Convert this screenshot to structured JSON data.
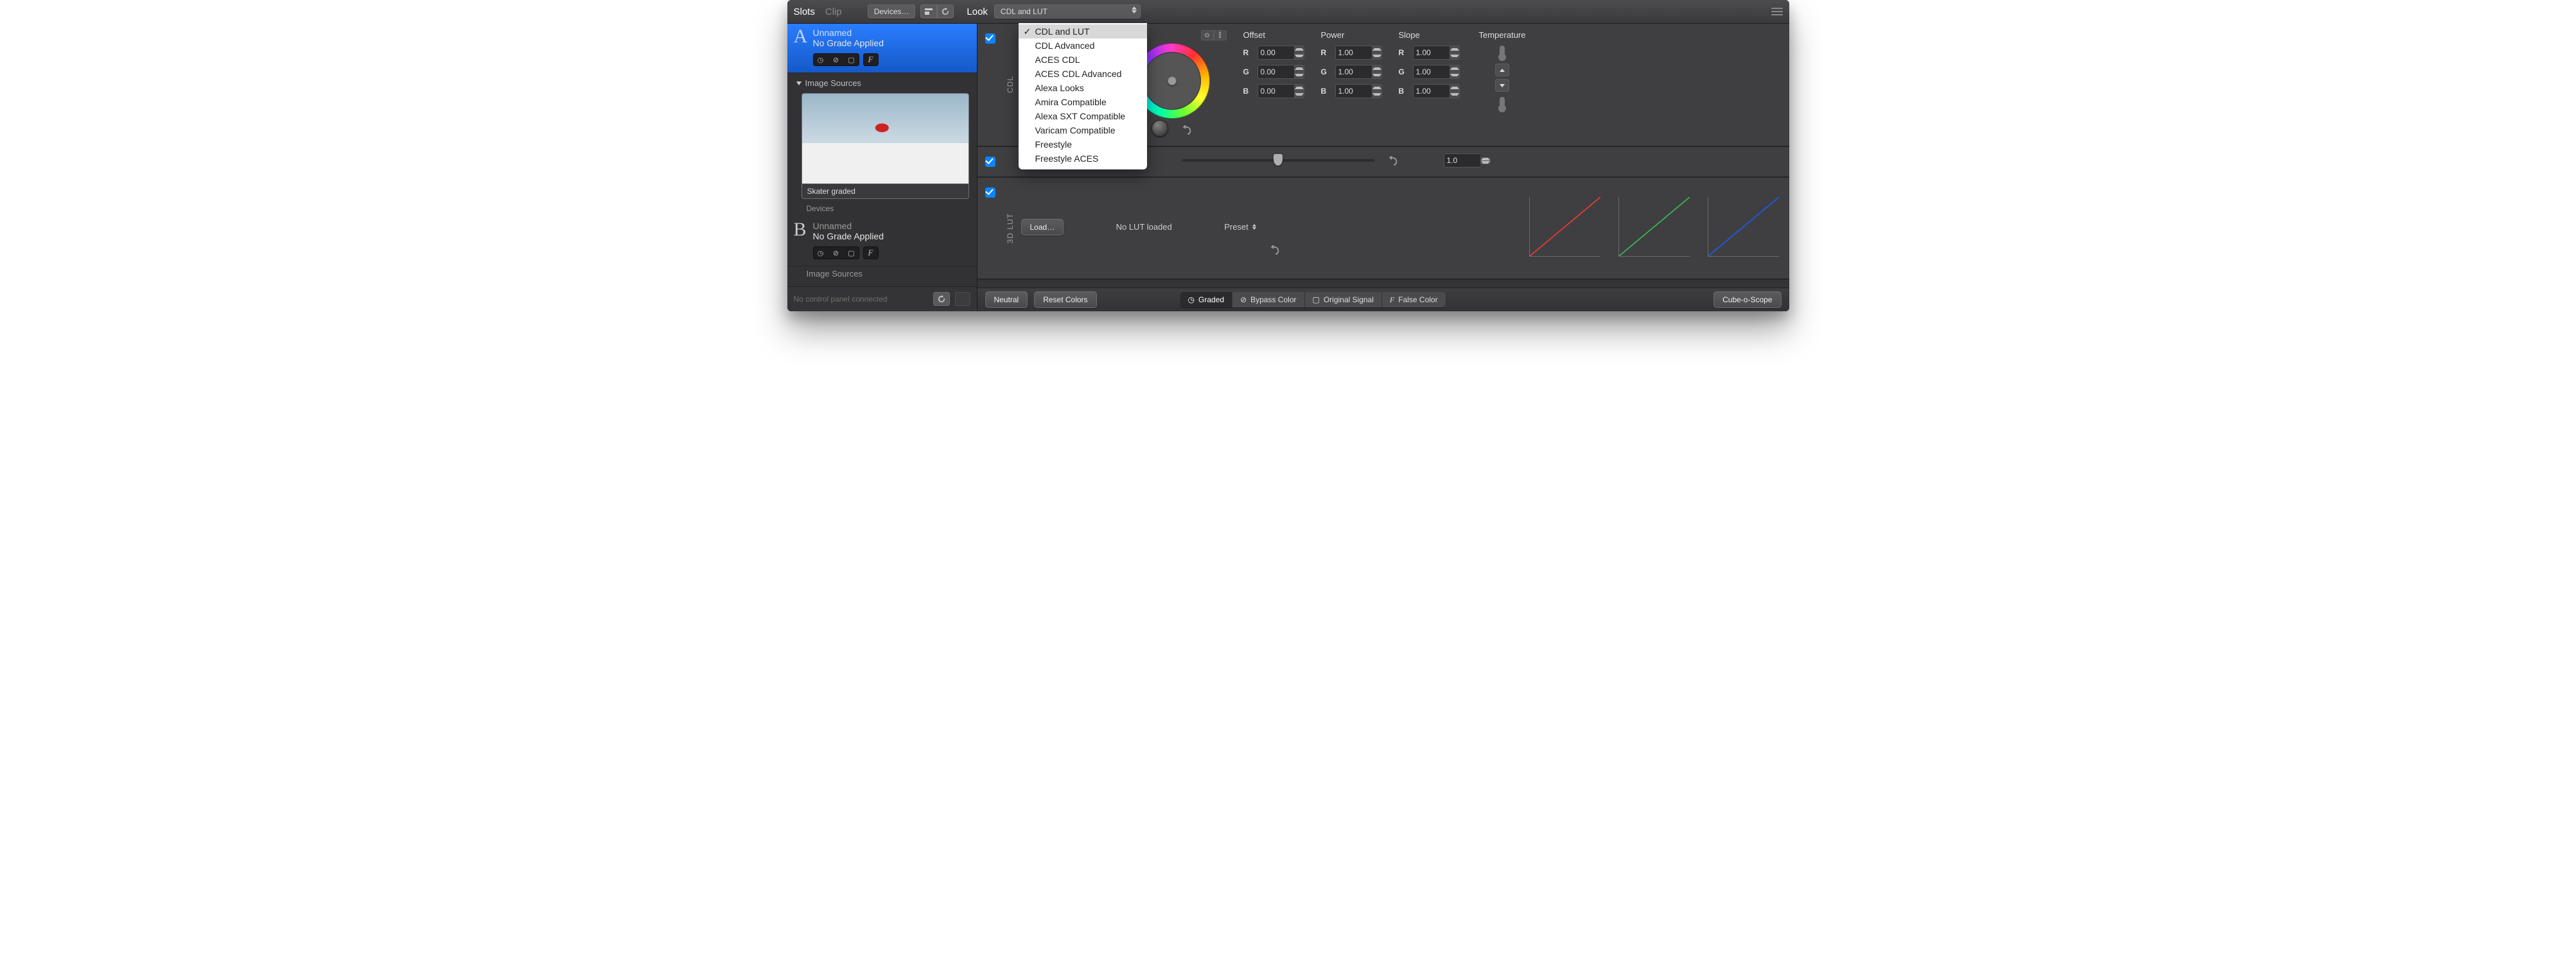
{
  "tabs": {
    "slots": "Slots",
    "clip": "Clip",
    "active": "slots"
  },
  "toolbar": {
    "devices_label": "Devices…"
  },
  "look": {
    "label": "Look",
    "selected": "CDL and LUT",
    "options": [
      "CDL and LUT",
      "CDL Advanced",
      "ACES CDL",
      "ACES CDL Advanced",
      "Alexa Looks",
      "Amira Compatible",
      "Alexa SXT Compatible",
      "Varicam Compatible",
      "Freestyle",
      "Freestyle ACES"
    ]
  },
  "sidebar": {
    "slotA": {
      "letter": "A",
      "name": "Unnamed",
      "sub": "No Grade Applied"
    },
    "slotB": {
      "letter": "B",
      "name": "Unnamed",
      "sub": "No Grade Applied"
    },
    "image_sources_label": "Image Sources",
    "thumb_label": "Skater graded",
    "devices_label": "Devices",
    "slotB_sources": "Image Sources",
    "footer_status": "No control panel connected"
  },
  "cdl": {
    "vlabel": "CDL",
    "wheel_partial_controls": "⊙ ⫿",
    "slope_label": "Slope",
    "offset": {
      "label": "Offset",
      "r": "0.00",
      "g": "0.00",
      "b": "0.00"
    },
    "power": {
      "label": "Power",
      "r": "1.00",
      "g": "1.00",
      "b": "1.00"
    },
    "slope2": {
      "label": "Slope",
      "r": "1.00",
      "g": "1.00",
      "b": "1.00"
    },
    "temperature_label": "Temperature"
  },
  "sat": {
    "value": "1.0"
  },
  "lut": {
    "vlabel": "3D LUT",
    "load_label": "Load…",
    "status": "No LUT loaded",
    "preset_label": "Preset"
  },
  "bottom": {
    "neutral": "Neutral",
    "reset": "Reset Colors",
    "graded": "Graded",
    "bypass": "Bypass Color",
    "original": "Original Signal",
    "false": "False Color",
    "cube": "Cube-o-Scope"
  },
  "chan": {
    "r": "R",
    "g": "G",
    "b": "B"
  }
}
